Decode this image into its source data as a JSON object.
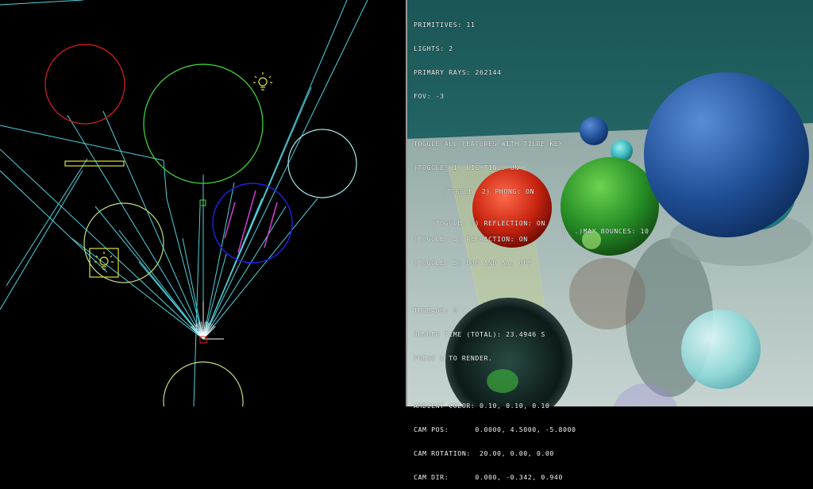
{
  "stats": {
    "primitives": "PRIMITIVES: 11",
    "lights": "LIGHTS: 2",
    "primary_rays": "PRIMARY RAYS: 262144",
    "fov": "FOV: -3"
  },
  "toggles": {
    "header": "TOGGLE ALL FEATURES WITH TILDE KEY",
    "lighting": "(TOGGLE: 1) LIGHTING: ON",
    "phong": "(TOGGLE: 2) PHONG: ON",
    "reflection": "(TOGGLE: 3) REFLECTION: ON",
    "max_bounces": "(, .)MAX BOUNCES: 10",
    "refraction": "(TOGGLE: 4) REFRACTION: ON",
    "dof_aa": "(TOGGLE: 5) DOF AND AA: OFF"
  },
  "render": {
    "threads": "THREADS: 8",
    "render_time": "RENDER TIME (TOTAL): 23.4946 S",
    "press_r": "PRESS R TO RENDER."
  },
  "camera": {
    "ambient": "AMBIENT COLOR: 0.10, 0.10, 0.10",
    "cam_pos": "CAM POS:      0.0000, 4.5000, -5.8000",
    "cam_rotation": "CAM ROTATION:  20.00, 0.00, 0.00",
    "cam_dir": "CAM DIR:      0.000, -0.342, 0.940"
  },
  "colors": {
    "ray": "#4fd3e0",
    "hud_text": "#eef4f2",
    "sky": "#1f5c5c",
    "floor": "#b4c6c2"
  },
  "icons": [
    "light-bulb-icon",
    "camera-icon"
  ]
}
